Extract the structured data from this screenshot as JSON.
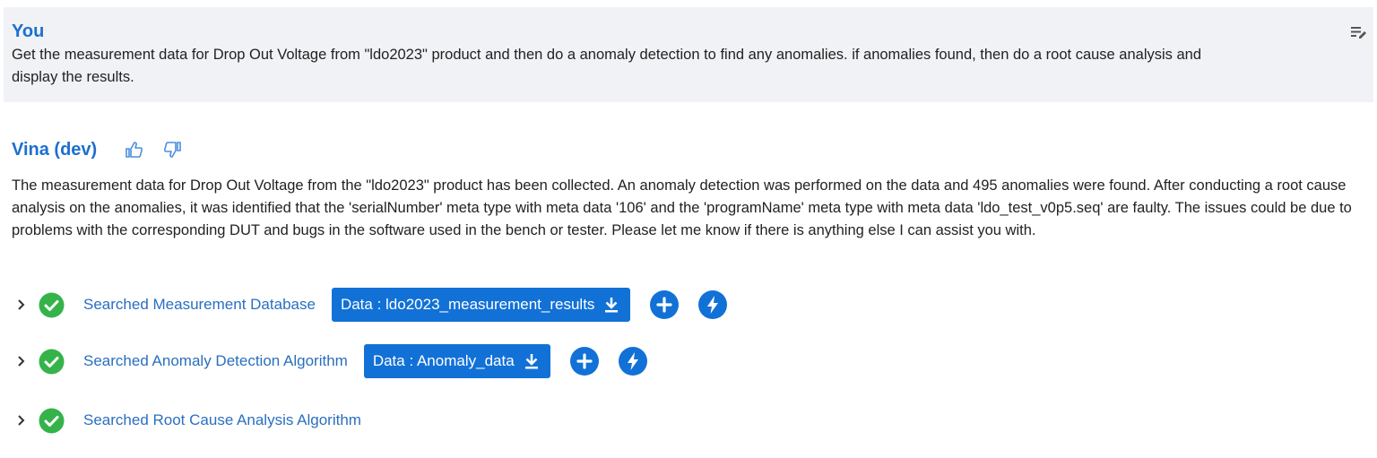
{
  "user_message": {
    "speaker": "You",
    "text_line1": "Get the measurement data for Drop Out Voltage from \"ldo2023\" product and then do a anomaly detection to find any anomalies. if anomalies found, then do a root cause analysis and",
    "text_line2": "display the results."
  },
  "bot_message": {
    "speaker": "Vina (dev)",
    "text": "The measurement data for Drop Out Voltage from the \"ldo2023\" product has been collected. An anomaly detection was performed on the data and 495 anomalies were found. After conducting a root cause analysis on the anomalies, it was identified that the 'serialNumber' meta type with meta data '106' and the 'programName' meta type with meta data 'ldo_test_v0p5.seq' are faulty. The issues could be due to problems with the corresponding DUT and bugs in the software used in the bench or tester. Please let me know if there is anything else I can assist you with."
  },
  "steps": [
    {
      "label": "Searched Measurement Database",
      "data_button": "Data : ldo2023_measurement_results"
    },
    {
      "label": "Searched Anomaly Detection Algorithm",
      "data_button": "Data : Anomaly_data"
    },
    {
      "label": "Searched Root Cause Analysis Algorithm"
    }
  ],
  "colors": {
    "accent": "#1c6fd0",
    "button_blue": "#1271d6",
    "success_green": "#35b34a",
    "user_bg": "#f1f2f6"
  },
  "icons": [
    "edit-icon",
    "thumbs-up-icon",
    "thumbs-down-icon",
    "chevron-right-icon",
    "check-circle-icon",
    "download-icon",
    "plus-circle-icon",
    "bolt-circle-icon"
  ]
}
